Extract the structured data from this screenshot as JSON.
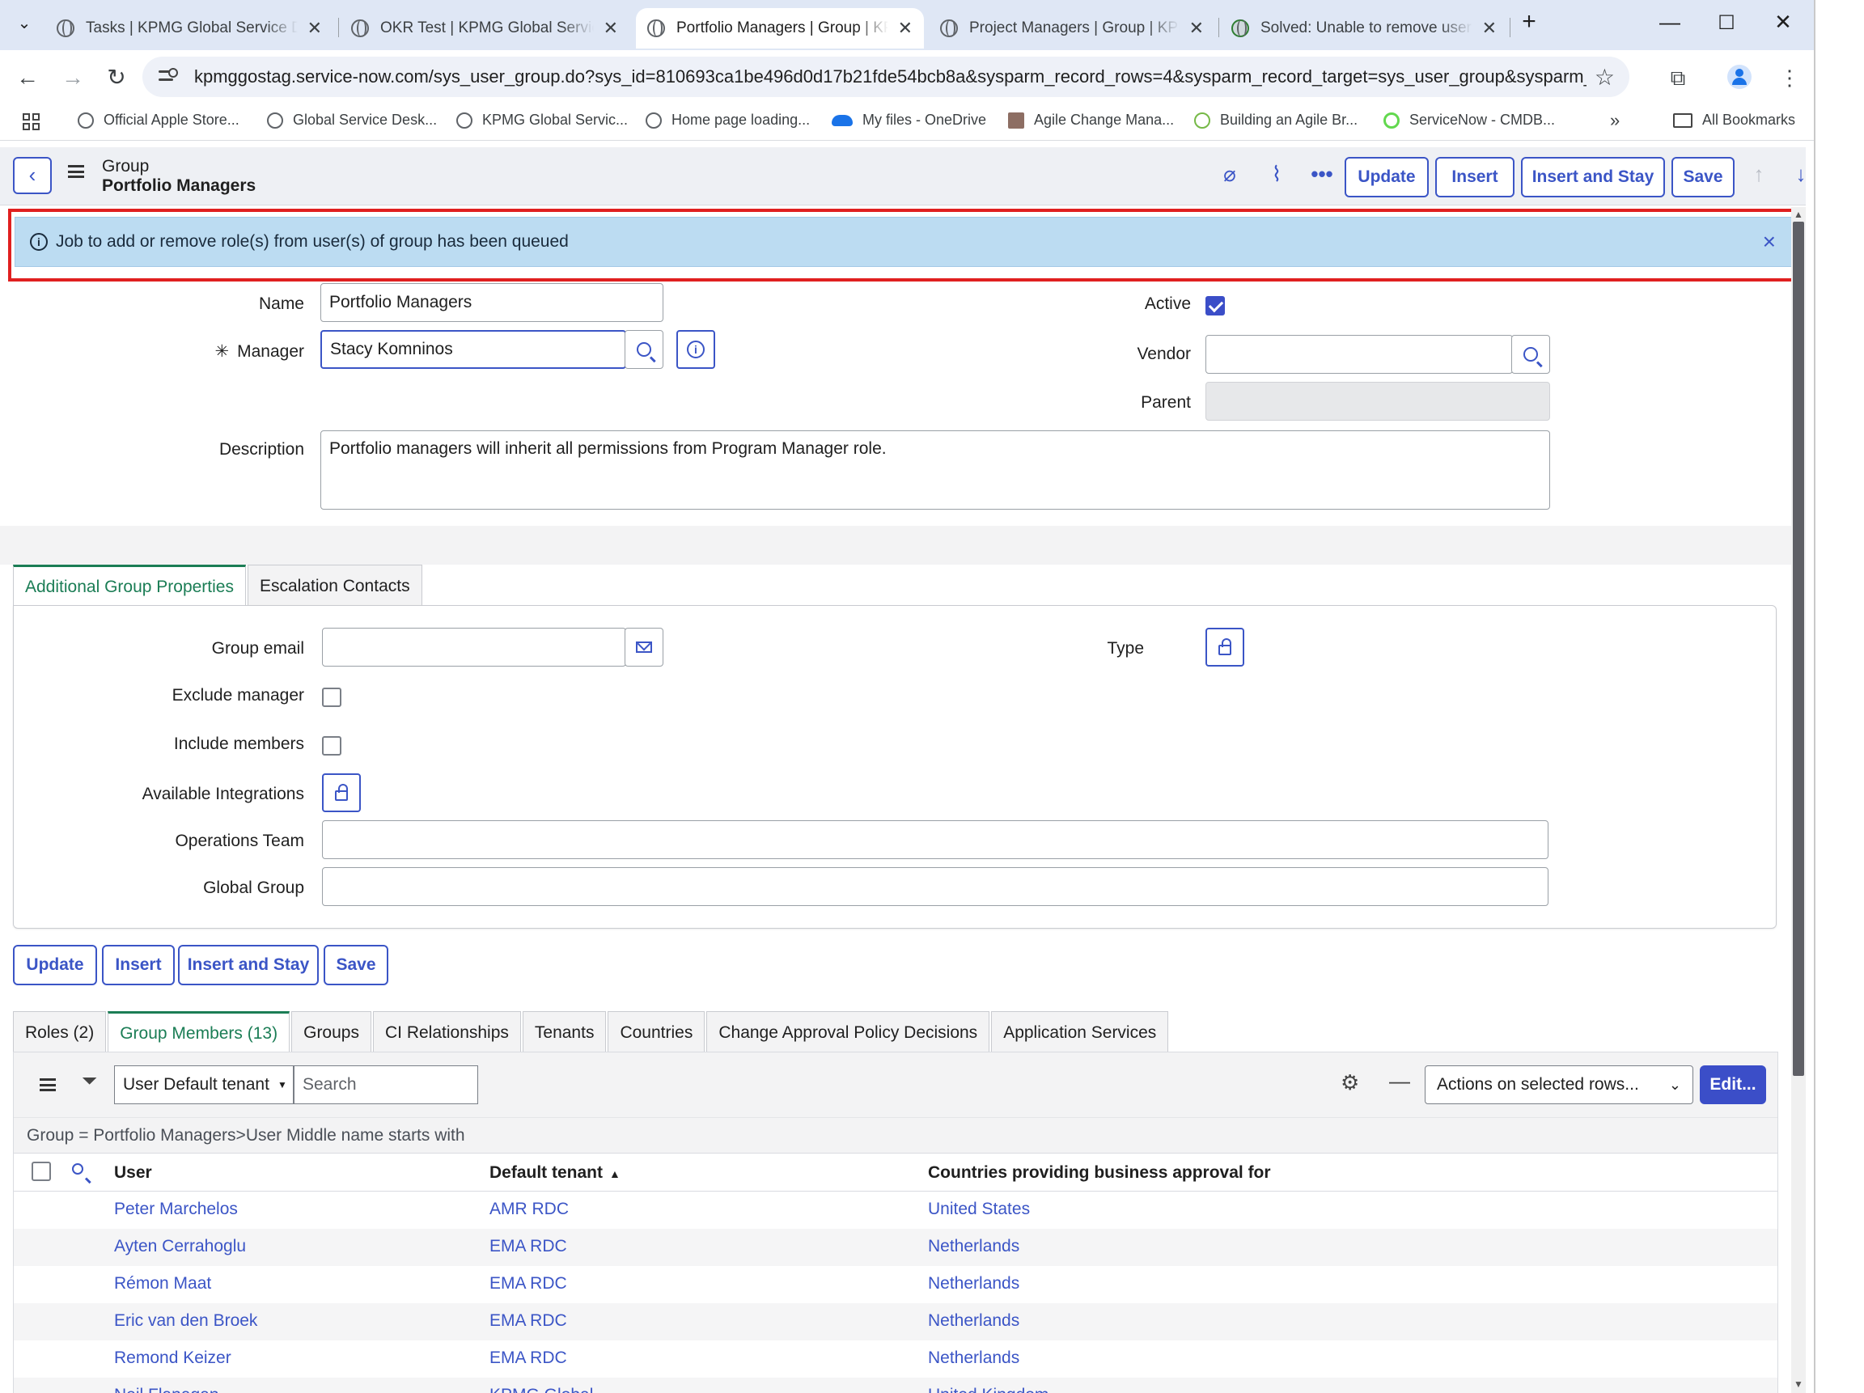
{
  "browser": {
    "tabs": [
      {
        "title": "Tasks | KPMG Global Service De"
      },
      {
        "title": "OKR Test | KPMG Global Service"
      },
      {
        "title": "Portfolio Managers | Group | KP"
      },
      {
        "title": "Project Managers | Group | KPM"
      },
      {
        "title": "Solved: Unable to remove users"
      }
    ],
    "url": "kpmggostag.service-now.com/sys_user_group.do?sys_id=810693ca1be496d0d17b21fde54bcb8a&sysparm_record_rows=4&sysparm_record_target=sys_user_group&sysparm_record_...",
    "bookmarks": [
      "Official Apple Store...",
      "Global Service Desk...",
      "KPMG Global Servic...",
      "Home page loading...",
      "My files - OneDrive",
      "Agile Change Mana...",
      "Building an Agile Br...",
      "ServiceNow - CMDB..."
    ],
    "all_bookmarks": "All Bookmarks"
  },
  "header": {
    "table_label": "Group",
    "record_name": "Portfolio Managers",
    "buttons": {
      "update": "Update",
      "insert": "Insert",
      "insert_stay": "Insert and Stay",
      "save": "Save"
    }
  },
  "banner": {
    "message": "Job to add or remove role(s) from user(s) of group has been queued"
  },
  "form": {
    "name_label": "Name",
    "name_value": "Portfolio Managers",
    "manager_label": "Manager",
    "manager_value": "Stacy Komninos",
    "active_label": "Active",
    "vendor_label": "Vendor",
    "vendor_value": "",
    "parent_label": "Parent",
    "description_label": "Description",
    "description_value": "Portfolio managers will inherit all permissions from Program Manager role."
  },
  "section_tabs": [
    "Additional Group Properties",
    "Escalation Contacts"
  ],
  "props": {
    "group_email_label": "Group email",
    "type_label": "Type",
    "exclude_manager_label": "Exclude manager",
    "include_members_label": "Include members",
    "available_integrations_label": "Available Integrations",
    "operations_team_label": "Operations Team",
    "global_group_label": "Global Group"
  },
  "bottom_buttons": {
    "update": "Update",
    "insert": "Insert",
    "insert_stay": "Insert and Stay",
    "save": "Save"
  },
  "related_tabs": [
    "Roles (2)",
    "Group Members (13)",
    "Groups",
    "CI Relationships",
    "Tenants",
    "Countries",
    "Change Approval Policy Decisions",
    "Application Services"
  ],
  "list": {
    "filter_select": "User Default tenant",
    "search_placeholder": "Search",
    "actions_select": "Actions on selected rows...",
    "edit_button": "Edit...",
    "breadcrumb": "Group = Portfolio Managers>User Middle name starts with",
    "columns": [
      "User",
      "Default tenant",
      "Countries providing business approval for"
    ],
    "rows": [
      {
        "user": "Peter Marchelos",
        "tenant": "AMR RDC",
        "country": "United States"
      },
      {
        "user": "Ayten Cerrahoglu",
        "tenant": "EMA RDC",
        "country": "Netherlands"
      },
      {
        "user": "Rémon Maat",
        "tenant": "EMA RDC",
        "country": "Netherlands"
      },
      {
        "user": "Eric van den Broek",
        "tenant": "EMA RDC",
        "country": "Netherlands"
      },
      {
        "user": "Remond Keizer",
        "tenant": "EMA RDC",
        "country": "Netherlands"
      },
      {
        "user": "Neil Flanagan",
        "tenant": "KPMG Global",
        "country": "United Kingdom"
      }
    ]
  },
  "colors": {
    "accent": "#3b55c6",
    "active_tab": "#1b7d55",
    "banner_bg": "#bcdcf2",
    "highlight_box": "#e02020"
  }
}
